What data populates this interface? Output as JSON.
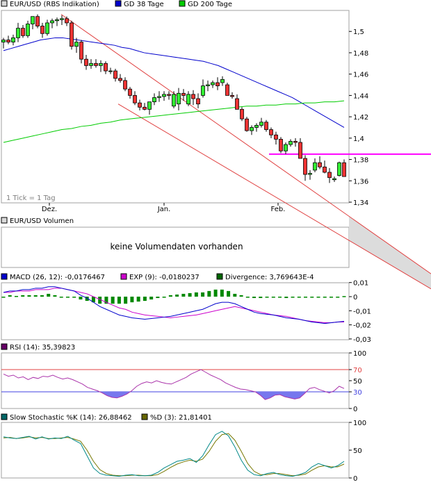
{
  "chart_data": [
    {
      "type": "candlestick",
      "legend": [
        {
          "label": "EUR/USD (RBS Indikation)",
          "color": "#d9d9d9"
        },
        {
          "label": "GD 38 Tage",
          "color": "#0000cc"
        },
        {
          "label": "GD 200 Tage",
          "color": "#00cc00"
        }
      ],
      "ylim": [
        1.34,
        1.52
      ],
      "yticks": [
        "1,5",
        "1,48",
        "1,46",
        "1,44",
        "1,42",
        "1,4",
        "1,38",
        "1,36",
        "1,34"
      ],
      "xticks": [
        "Dez.",
        "Jan.",
        "Feb."
      ],
      "note": "1 Tick = 1 Tag",
      "ohlc": [
        [
          1.49,
          1.494,
          1.484,
          1.492
        ],
        [
          1.492,
          1.496,
          1.488,
          1.49
        ],
        [
          1.49,
          1.497,
          1.487,
          1.494
        ],
        [
          1.494,
          1.508,
          1.49,
          1.503
        ],
        [
          1.503,
          1.506,
          1.494,
          1.496
        ],
        [
          1.496,
          1.51,
          1.494,
          1.507
        ],
        [
          1.507,
          1.514,
          1.502,
          1.514
        ],
        [
          1.514,
          1.516,
          1.503,
          1.505
        ],
        [
          1.505,
          1.508,
          1.494,
          1.498
        ],
        [
          1.498,
          1.511,
          1.496,
          1.508
        ],
        [
          1.508,
          1.512,
          1.503,
          1.51
        ],
        [
          1.51,
          1.513,
          1.505,
          1.511
        ],
        [
          1.511,
          1.515,
          1.506,
          1.512
        ],
        [
          1.512,
          1.514,
          1.505,
          1.508
        ],
        [
          1.508,
          1.51,
          1.483,
          1.486
        ],
        [
          1.486,
          1.494,
          1.48,
          1.49
        ],
        [
          1.49,
          1.492,
          1.47,
          1.474
        ],
        [
          1.474,
          1.478,
          1.464,
          1.468
        ],
        [
          1.468,
          1.474,
          1.465,
          1.47
        ],
        [
          1.47,
          1.474,
          1.466,
          1.468
        ],
        [
          1.468,
          1.473,
          1.462,
          1.47
        ],
        [
          1.47,
          1.472,
          1.46,
          1.463
        ],
        [
          1.463,
          1.466,
          1.46,
          1.463
        ],
        [
          1.463,
          1.465,
          1.453,
          1.456
        ],
        [
          1.456,
          1.46,
          1.452,
          1.454
        ],
        [
          1.454,
          1.457,
          1.444,
          1.446
        ],
        [
          1.446,
          1.448,
          1.437,
          1.44
        ],
        [
          1.44,
          1.444,
          1.431,
          1.433
        ],
        [
          1.433,
          1.436,
          1.426,
          1.429
        ],
        [
          1.429,
          1.433,
          1.426,
          1.427
        ],
        [
          1.427,
          1.434,
          1.422,
          1.434
        ],
        [
          1.434,
          1.442,
          1.431,
          1.438
        ],
        [
          1.438,
          1.444,
          1.434,
          1.439
        ],
        [
          1.439,
          1.444,
          1.435,
          1.441
        ],
        [
          1.441,
          1.444,
          1.436,
          1.44
        ],
        [
          1.43,
          1.444,
          1.428,
          1.441
        ],
        [
          1.432,
          1.447,
          1.426,
          1.442
        ],
        [
          1.442,
          1.446,
          1.435,
          1.44
        ],
        [
          1.432,
          1.444,
          1.43,
          1.441
        ],
        [
          1.441,
          1.445,
          1.431,
          1.437
        ],
        [
          1.437,
          1.442,
          1.428,
          1.432
        ],
        [
          1.44,
          1.455,
          1.438,
          1.449
        ],
        [
          1.449,
          1.454,
          1.444,
          1.45
        ],
        [
          1.45,
          1.454,
          1.447,
          1.452
        ],
        [
          1.452,
          1.457,
          1.445,
          1.449
        ],
        [
          1.452,
          1.458,
          1.449,
          1.455
        ],
        [
          1.45,
          1.452,
          1.441,
          1.44
        ],
        [
          1.44,
          1.443,
          1.437,
          1.439
        ],
        [
          1.437,
          1.441,
          1.427,
          1.427
        ],
        [
          1.427,
          1.429,
          1.416,
          1.418
        ],
        [
          1.418,
          1.42,
          1.406,
          1.407
        ],
        [
          1.407,
          1.412,
          1.403,
          1.41
        ],
        [
          1.41,
          1.414,
          1.406,
          1.412
        ],
        [
          1.412,
          1.419,
          1.41,
          1.415
        ],
        [
          1.415,
          1.417,
          1.406,
          1.408
        ],
        [
          1.408,
          1.41,
          1.4,
          1.403
        ],
        [
          1.403,
          1.406,
          1.394,
          1.399
        ],
        [
          1.399,
          1.401,
          1.386,
          1.388
        ],
        [
          1.388,
          1.396,
          1.385,
          1.394
        ],
        [
          1.394,
          1.399,
          1.392,
          1.397
        ],
        [
          1.397,
          1.4,
          1.392,
          1.396
        ],
        [
          1.396,
          1.4,
          1.384,
          1.381
        ],
        [
          1.381,
          1.384,
          1.36,
          1.366
        ],
        [
          1.366,
          1.37,
          1.361,
          1.367
        ],
        [
          1.37,
          1.381,
          1.368,
          1.377
        ],
        [
          1.377,
          1.383,
          1.371,
          1.373
        ],
        [
          1.373,
          1.379,
          1.367,
          1.368
        ],
        [
          1.368,
          1.372,
          1.358,
          1.363
        ],
        [
          1.361,
          1.364,
          1.359,
          1.362
        ],
        [
          1.365,
          1.378,
          1.364,
          1.377
        ],
        [
          1.377,
          1.38,
          1.366,
          1.364
        ]
      ],
      "gd38": [
        1.482,
        1.484,
        1.486,
        1.488,
        1.49,
        1.492,
        1.493,
        1.494,
        1.494,
        1.493,
        1.492,
        1.491,
        1.49,
        1.489,
        1.488,
        1.487,
        1.485,
        1.484,
        1.482,
        1.48,
        1.479,
        1.478,
        1.477,
        1.476,
        1.475,
        1.474,
        1.473,
        1.472,
        1.47,
        1.468,
        1.465,
        1.462,
        1.459,
        1.456,
        1.453,
        1.45,
        1.447,
        1.444,
        1.441,
        1.438,
        1.434,
        1.43,
        1.426,
        1.422,
        1.418,
        1.414,
        1.41
      ],
      "gd38_start_index": 24,
      "gd200": [
        1.396,
        1.398,
        1.4,
        1.402,
        1.404,
        1.406,
        1.408,
        1.409,
        1.411,
        1.412,
        1.414,
        1.415,
        1.417,
        1.418,
        1.419,
        1.42,
        1.421,
        1.422,
        1.423,
        1.424,
        1.425,
        1.426,
        1.427,
        1.428,
        1.429,
        1.43,
        1.43,
        1.431,
        1.431,
        1.432,
        1.432,
        1.433,
        1.433,
        1.434,
        1.434,
        1.435
      ],
      "resistance_level": 1.385
    },
    {
      "type": "bar",
      "legend": [
        {
          "label": "EUR/USD Volumen",
          "color": "#d9d9d9"
        }
      ],
      "message": "keine Volumendaten vorhanden"
    },
    {
      "type": "line",
      "legend": [
        {
          "label": "MACD (26, 12): -0,0176467",
          "color": "#0000cc"
        },
        {
          "label": "EXP (9): -0,0180237",
          "color": "#cc00cc"
        },
        {
          "label": "Divergence: 3,769643E-4",
          "color": "#006600"
        }
      ],
      "ylim": [
        -0.03,
        0.01
      ],
      "yticks": [
        "0,01",
        "0",
        "-0,01",
        "-0,02",
        "-0,03"
      ],
      "macd": [
        0.003,
        0.004,
        0.004,
        0.005,
        0.005,
        0.006,
        0.006,
        0.007,
        0.007,
        0.006,
        0.005,
        0.004,
        0.001,
        -0.001,
        -0.004,
        -0.007,
        -0.009,
        -0.011,
        -0.013,
        -0.014,
        -0.015,
        -0.0155,
        -0.016,
        -0.0155,
        -0.015,
        -0.0145,
        -0.014,
        -0.013,
        -0.012,
        -0.011,
        -0.01,
        -0.009,
        -0.007,
        -0.005,
        -0.004,
        -0.004,
        -0.005,
        -0.007,
        -0.009,
        -0.011,
        -0.012,
        -0.0125,
        -0.013,
        -0.014,
        -0.015,
        -0.0155,
        -0.016,
        -0.017,
        -0.018,
        -0.0185,
        -0.019,
        -0.0185,
        -0.018,
        -0.0175
      ],
      "signal": [
        0.003,
        0.003,
        0.004,
        0.004,
        0.004,
        0.005,
        0.005,
        0.005,
        0.006,
        0.006,
        0.005,
        0.004,
        0.003,
        0.002,
        0.0,
        -0.002,
        -0.004,
        -0.006,
        -0.008,
        -0.009,
        -0.011,
        -0.012,
        -0.013,
        -0.0135,
        -0.014,
        -0.0145,
        -0.015,
        -0.0145,
        -0.014,
        -0.0135,
        -0.013,
        -0.012,
        -0.011,
        -0.01,
        -0.009,
        -0.008,
        -0.007,
        -0.008,
        -0.009,
        -0.01,
        -0.011,
        -0.012,
        -0.013,
        -0.0135,
        -0.014,
        -0.015,
        -0.016,
        -0.017,
        -0.0175,
        -0.018,
        -0.0185,
        -0.0185,
        -0.018,
        -0.018
      ],
      "divergence": [
        0.0,
        0.001,
        0.0005,
        0.001,
        0.001,
        0.001,
        0.001,
        0.002,
        0.001,
        0.0,
        0.0,
        0.0,
        -0.002,
        -0.003,
        -0.004,
        -0.005,
        -0.005,
        -0.005,
        -0.005,
        -0.005,
        -0.004,
        -0.0035,
        -0.003,
        -0.002,
        -0.001,
        0.0,
        0.001,
        0.0015,
        0.002,
        0.0025,
        0.003,
        0.003,
        0.004,
        0.005,
        0.005,
        0.004,
        0.002,
        0.001,
        0.0,
        -0.001,
        -0.001,
        -0.0005,
        0.0,
        -0.0005,
        -0.001,
        -0.0005,
        0.0,
        0.0,
        -0.0005,
        -0.0005,
        -0.0005,
        0.0,
        0.0,
        0.0004
      ]
    },
    {
      "type": "line",
      "legend": [
        {
          "label": "RSI (14): 35,39823",
          "color": "#660066"
        }
      ],
      "ylim": [
        0,
        100
      ],
      "yticks": [
        "100",
        "70",
        "50",
        "30",
        "0"
      ],
      "levels": [
        70,
        30
      ],
      "rsi": [
        62,
        58,
        60,
        55,
        57,
        52,
        56,
        54,
        58,
        57,
        60,
        56,
        53,
        55,
        52,
        48,
        44,
        38,
        35,
        32,
        28,
        23,
        20,
        19,
        22,
        26,
        32,
        40,
        45,
        48,
        46,
        50,
        47,
        45,
        44,
        48,
        52,
        56,
        62,
        66,
        70,
        65,
        60,
        56,
        52,
        46,
        42,
        38,
        35,
        34,
        32,
        30,
        24,
        16,
        19,
        24,
        25,
        21,
        19,
        17,
        19,
        27,
        36,
        38,
        34,
        31,
        28,
        32,
        40,
        36
      ]
    },
    {
      "type": "line",
      "legend": [
        {
          "label": "Slow Stochastic %K (14): 26,88462",
          "color": "#006666"
        },
        {
          "label": "%D (3): 21,81401",
          "color": "#666600"
        }
      ],
      "ylim": [
        0,
        100
      ],
      "yticks": [
        "100",
        "50",
        "0"
      ],
      "k": [
        74,
        72,
        71,
        73,
        75,
        70,
        74,
        70,
        72,
        71,
        75,
        68,
        62,
        40,
        18,
        8,
        5,
        4,
        3,
        5,
        6,
        4,
        4,
        5,
        10,
        18,
        24,
        30,
        32,
        35,
        28,
        40,
        60,
        78,
        84,
        76,
        56,
        32,
        14,
        6,
        4,
        8,
        10,
        6,
        4,
        3,
        6,
        10,
        20,
        26,
        22,
        18,
        22,
        30
      ],
      "d": [
        72,
        73,
        71,
        72,
        74,
        72,
        73,
        71,
        71,
        72,
        73,
        70,
        66,
        50,
        30,
        15,
        8,
        5,
        4,
        4,
        5,
        5,
        4,
        4,
        6,
        12,
        19,
        25,
        29,
        32,
        30,
        34,
        48,
        66,
        78,
        80,
        68,
        48,
        26,
        12,
        6,
        6,
        8,
        8,
        6,
        4,
        5,
        7,
        14,
        20,
        22,
        20,
        20,
        25
      ]
    }
  ]
}
